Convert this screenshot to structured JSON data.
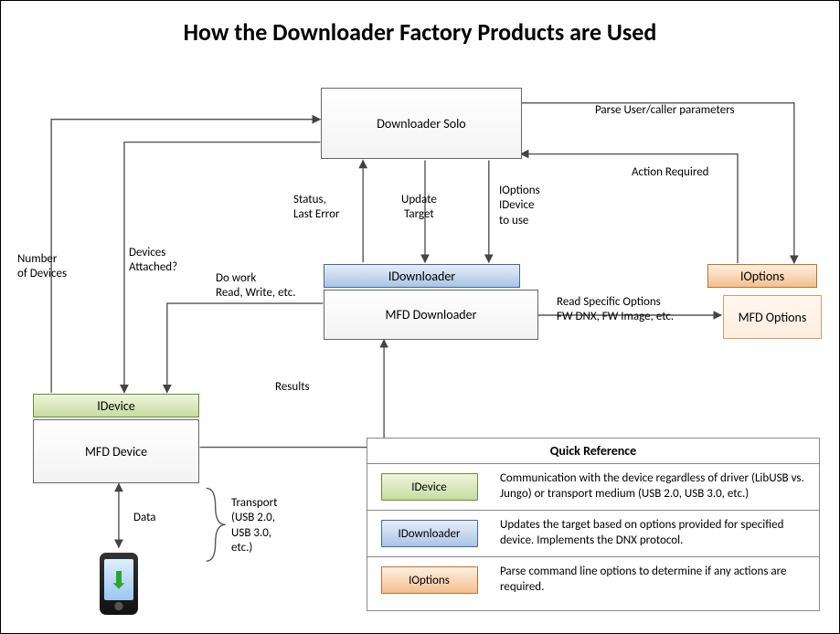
{
  "title": "How the Downloader Factory Products are Used",
  "nodes": {
    "downloader_solo": "Downloader Solo",
    "idownloader": "IDownloader",
    "mfd_downloader": "MFD Downloader",
    "ioptions": "IOptions",
    "mfd_options": "MFD Options",
    "idevice": "IDevice",
    "mfd_device": "MFD Device"
  },
  "edges": {
    "parse_user_caller": "Parse User/caller parameters",
    "action_required": "Action Required",
    "status_last_error": "Status,\nLast Error",
    "update_target": "Update\nTarget",
    "ioptions_idevice_to_use": "IOptions\nIDevice\nto use",
    "read_specific_options": "Read Specific Options\nFW DNX, FW Image, etc.",
    "number_of_devices": "Number\nof Devices",
    "devices_attached": "Devices\nAttached?",
    "do_work": "Do work\nRead, Write, etc.",
    "results": "Results",
    "data": "Data",
    "transport": "Transport\n(USB 2.0,\nUSB 3.0,\netc.)"
  },
  "quick_reference": {
    "title": "Quick Reference",
    "rows": [
      {
        "chip": "IDevice",
        "chip_class": "idevice",
        "desc": "Communication with the device regardless of driver (LibUSB vs. Jungo) or transport medium (USB 2.0, USB 3.0, etc.)"
      },
      {
        "chip": "IDownloader",
        "chip_class": "idownloader",
        "desc": "Updates the target based on options provided for specified device. Implements the DNX protocol."
      },
      {
        "chip": "IOptions",
        "chip_class": "ioptions",
        "desc": "Parse command line options to determine if any actions are required."
      }
    ]
  }
}
